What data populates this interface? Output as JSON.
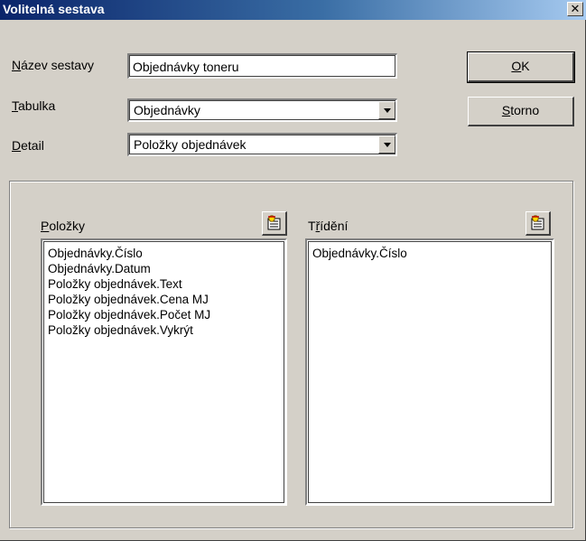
{
  "window": {
    "title": "Volitelná sestava",
    "close_glyph": "✕"
  },
  "form": {
    "name": {
      "label_hot": "N",
      "label_rest": "ázev sestavy",
      "value": "Objednávky toneru"
    },
    "table": {
      "label_hot": "T",
      "label_rest": "abulka",
      "value": "Objednávky"
    },
    "detail": {
      "label_hot": "D",
      "label_rest": "etail",
      "value": "Položky objednávek"
    }
  },
  "buttons": {
    "ok": {
      "hot": "O",
      "rest": "K"
    },
    "cancel": {
      "hot": "S",
      "rest": "torno"
    }
  },
  "items_panel": {
    "label_hot": "P",
    "label_rest": "oložky",
    "icon": "wizard-icon",
    "items": [
      "Objednávky.Číslo",
      "Objednávky.Datum",
      "Položky objednávek.Text",
      "Položky objednávek.Cena MJ",
      "Položky objednávek.Počet MJ",
      "Položky objednávek.Vykrýt"
    ]
  },
  "sort_panel": {
    "label_pre": "T",
    "label_hot": "ř",
    "label_rest": "ídění",
    "icon": "wizard-icon",
    "items": [
      "Objednávky.Číslo"
    ]
  }
}
